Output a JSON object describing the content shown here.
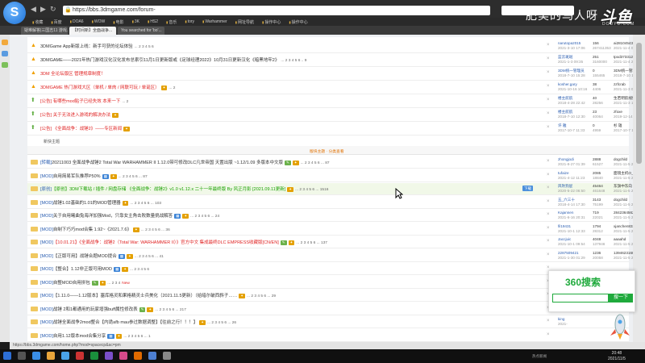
{
  "browser": {
    "url": "https://bbs.3dmgame.com/forum-",
    "bookmarks": [
      "收藏",
      "百度",
      "DOA6",
      "WOW",
      "电影",
      "3K",
      "HS2",
      "音乐",
      "tory",
      "Warhammer",
      "网址导航",
      "操作中心",
      "操作中心"
    ],
    "tabs": [
      "疑难解答|三国志11 游戏...",
      "【时间新】全面战争...",
      "You searched for 'bo'..."
    ],
    "status": "https://bbs.3dmgame.com/home.php?mod=spacecp&ac=pm"
  },
  "watermark": {
    "text": "肥美的鸟人呀",
    "brand": "斗鱼",
    "sub": "DOUYU.COM"
  },
  "forum": {
    "sticky": [
      {
        "icon": "ann",
        "color": "normal",
        "title": "3DMGame App新版上线：新手可获的论坛体验",
        "badges": [],
        "pages": "... 2 3 4 5 6",
        "author": "narutopa2015",
        "date": "2021-3-10 17:06",
        "replies": "156",
        "views": "267411353",
        "last_user": "ai281045439",
        "last_date": "2021-11-4 08:40"
      },
      {
        "icon": "ann",
        "color": "normal",
        "title": "3DMGAME——2021年热门游戏汉化汉化发布总索引11月1日更新版或《足球经理2022》10月31日更新汉化《暗黑地牢2》",
        "badges": [],
        "pages": "... 2 3 4 5 6 .. 9",
        "author": "蓝云斑斑",
        "date": "2021-1-3 09:35",
        "replies": "251",
        "views": "3160000",
        "last_user": "tpxd37331299",
        "last_date": "2021-11-4 23:56"
      },
      {
        "icon": "ann",
        "color": "red",
        "title": "3DM 全论坛版区 管理规章制度！",
        "badges": [],
        "pages": "",
        "author": "3DM统一管理员",
        "date": "2018-7-10 15:28",
        "replies": "0",
        "views": "155465",
        "last_user": "3DM统一管理员",
        "last_date": "2018-7-10 15:28"
      },
      {
        "icon": "ann",
        "color": "red",
        "title": "3DMGAME 热门游戏大区（单机 / 单肉 / 网联可玩 / 单诞区）",
        "badges": [
          "y"
        ],
        "pages": "... 2",
        "author": "kosher.gary",
        "date": "2021-10-16 10:16",
        "replies": "38",
        "views": "4406",
        "last_user": "zzfcrab",
        "last_date": "2021-11-3 00:15"
      },
      {
        "icon": "up",
        "color": "red",
        "title": "[公告] 有哪些mod贴子已经失效 本来一下",
        "badges": [],
        "pages": "... 2",
        "author": "楼主航航",
        "date": "2018-4-28 22:42",
        "replies": "40",
        "views": "28256",
        "last_user": "生若明航线好",
        "last_date": "2021-11-3 12:30"
      },
      {
        "icon": "up",
        "color": "red",
        "title": "[公告] 关于无法进入游戏的解决办法",
        "badges": [
          "y"
        ],
        "pages": "",
        "author": "楼主航航",
        "date": "2018-7-10 12:30",
        "replies": "23",
        "views": "40064",
        "last_user": "zfoxe",
        "last_date": "2019-12-14 12:54"
      },
      {
        "icon": "up",
        "color": "red",
        "title": "[公告] 《全面战争：战锤2》——专区新闻",
        "badges": [
          "y"
        ],
        "pages": "",
        "author": "许 雅",
        "date": "2017-10-7 11:33",
        "replies": "0",
        "views": "4959",
        "last_user": "杉 雄",
        "last_date": "2017-10-7 11:33"
      }
    ],
    "new_area": "新快主题",
    "separator": "版块主题 · 分类查看",
    "normal": [
      {
        "color": "normal",
        "tag": "[转载]",
        "title": "20211003 全面战争战锤2 Total War WARHAMMER II 1.12.0带可修改DLC凡世帝国 天置出版 ~1.12/1.09 多版本中文版",
        "badges": [
          "g",
          "y"
        ],
        "pages": "... 2 3 4 5 6 ... 87",
        "author": "zhongjodi",
        "date": "2021-8-27 01:39",
        "replies": "2888",
        "views": "61527",
        "last_user": "dogchild",
        "last_date": "2021-11-5 20:20"
      },
      {
        "color": "normal",
        "tag": "[MOD]",
        "title": "自用简易军队推荐P50%",
        "badges": [
          "b",
          "y"
        ],
        "pages": "... 2 3 4 5 6 ... 87",
        "author": "tufaize",
        "date": "2021-4-12 11:23",
        "replies": "2085",
        "views": "18840",
        "last_user": "面镜主机O_o",
        "last_date": "2021-11-5 20:18"
      },
      {
        "color": "green",
        "tag": "[原创]",
        "title": "【原创】3DM下载站 / 插件 / 网盘存储 《全面战争：战锤2》v1.0 v1.12.x 二十一年最终版 By 风正月影 [2021.09.11更新]",
        "badges": [
          "y"
        ],
        "pages": "... 2 3 4 5 6 ... 1516",
        "chip": "下载",
        "author": "风吹狗屁",
        "date": "2020-5-22 06:50",
        "replies": "45464",
        "views": "461648",
        "last_user": "东旗中东向",
        "last_date": "2021-11-5 20:16"
      },
      {
        "color": "normal",
        "tag": "[MOD]",
        "title": "战锤1.02基础的1.01的MOD管理器",
        "badges": [
          "y"
        ],
        "pages": "... 2 3 4 5 6 ... 103",
        "author": "五_六三十",
        "date": "2018-4-14 17:30",
        "replies": "3143",
        "views": "75199",
        "last_user": "dogchild",
        "last_date": "2021-11-5 20:13"
      },
      {
        "color": "normal",
        "tag": "[MOD]",
        "title": "关于自用曦曲兔海洋加强Mod，只靠女主角击败数量挑战解答",
        "badges": [
          "b",
          "y"
        ],
        "pages": "... 2 3 4 5 6 ... 24",
        "author": "Kajannen",
        "date": "2021-6-16 20:31",
        "replies": "719",
        "views": "22021",
        "last_user": "2842364562xh",
        "last_date": "2021-11-5 20:08"
      },
      {
        "color": "normal",
        "tag": "[MOD]",
        "title": "自制下巧巧mod合集 1.92~《2021.7.6》",
        "badges": [
          "y"
        ],
        "pages": "... 2 3 4 5 6 ... 36",
        "author": "fil19431",
        "date": "2021-10-1 12:33",
        "replies": "1794",
        "views": "28312",
        "last_user": "xjanchen8325",
        "last_date": "2021-11-5 20:06"
      },
      {
        "color": "red",
        "tag": "[MOD]",
        "title": "【10.01.21】《全面战争：战锤2（Total War: WARHAMMER II）》官方中文 集成最终DLC EMPRESS收藏版[CN/EN]",
        "badges": [
          "g",
          "y"
        ],
        "pages": "... 2 3 4 5 6 ... 137",
        "author": "Jaccjuic",
        "date": "2021-10-1 09:54",
        "replies": "4048",
        "views": "137946",
        "last_user": "aaaahd",
        "last_date": "2021-11-5 20:06"
      },
      {
        "color": "normal",
        "tag": "[MOD]",
        "title": "【正版可用】战锤合题MOD提合",
        "badges": [
          "b",
          "y"
        ],
        "pages": "... 2 3 4 5 6 ... 41",
        "author": "2287509421",
        "date": "2021-1-30 01:29",
        "replies": "1236",
        "views": "20058",
        "last_user": "13946231684",
        "last_date": "2021-11-5 20:04"
      },
      {
        "color": "normal",
        "tag": "[MOD]",
        "title": "【整合】1.12非正版可用MOD",
        "badges": [
          "b",
          "y"
        ],
        "pages": "... 2 3 4 5 6",
        "author": "",
        "date": "",
        "replies": "",
        "views": "",
        "last_user": "",
        "last_date": ""
      },
      {
        "color": "normal",
        "tag": "[MOD]",
        "title": "自整MOD自用拼包",
        "badges": [
          "g",
          "y"
        ],
        "pages": "... 2 3 4",
        "new": "New",
        "author": "",
        "date": "",
        "replies": "",
        "views": "",
        "last_user": "",
        "last_date": ""
      },
      {
        "color": "normal",
        "tag": "[MOD]",
        "title": "【1.11.0——1.12版本】塞库格灵和果格精灵士兵美化（2021.11.5更新）（给暗尔破西斜子……",
        "badges": [
          "y"
        ],
        "pages": "... 2 3 4 5 6 ... 29",
        "author": "yfyfc",
        "date": "2021-",
        "replies": "",
        "views": "",
        "last_user": "",
        "last_date": ""
      },
      {
        "color": "normal",
        "tag": "[MOD]",
        "title": "战锤 2和1都通用的玩家增强buff属性修改表",
        "badges": [
          "g",
          "y"
        ],
        "pages": "... 2 3 4 5 6 ... 217",
        "author": "",
        "date": "",
        "replies": "",
        "views": "",
        "last_user": "",
        "last_date": ""
      },
      {
        "color": "normal",
        "tag": "[MOD]",
        "title": "战锤全面战争2mod整合【内诡afb mau参过数据调整】【往前之行！！！】",
        "badges": [
          "y"
        ],
        "pages": "... 2 3 4 5 6 ... 26",
        "author": "king",
        "date": "2021-",
        "replies": "",
        "views": "",
        "last_user": "",
        "last_date": ""
      },
      {
        "color": "normal",
        "tag": "[MOD]",
        "title": "自用1.12版本mod合集分享",
        "badges": [
          "b",
          "y"
        ],
        "pages": "... 2 3 4 5 6 ... 1",
        "author": "",
        "date": "",
        "replies": "",
        "views": "",
        "last_user": "",
        "last_date": ""
      }
    ]
  },
  "popup": {
    "logo": "360搜索",
    "button": "搜一下"
  },
  "taskbar": {
    "time": "20:48",
    "date": "2021/11/5",
    "tray": "热点新闻"
  }
}
